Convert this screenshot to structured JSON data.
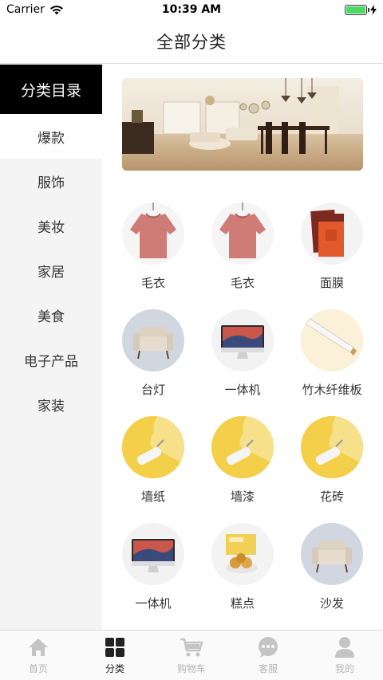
{
  "status": {
    "carrier": "Carrier",
    "time": "10:39 AM"
  },
  "nav": {
    "title": "全部分类"
  },
  "sidebar": {
    "header": "分类目录",
    "items": [
      {
        "label": "爆款",
        "active": true
      },
      {
        "label": "服饰"
      },
      {
        "label": "美妆"
      },
      {
        "label": "家居"
      },
      {
        "label": "美食"
      },
      {
        "label": "电子产品"
      },
      {
        "label": "家装"
      }
    ]
  },
  "banner": {
    "image": "living-room-photo"
  },
  "products": [
    {
      "label": "毛衣",
      "icon": "sweater"
    },
    {
      "label": "毛衣",
      "icon": "sweater"
    },
    {
      "label": "面膜",
      "icon": "face-mask"
    },
    {
      "label": "台灯",
      "icon": "armchair"
    },
    {
      "label": "一体机",
      "icon": "imac"
    },
    {
      "label": "竹木纤维板",
      "icon": "molding"
    },
    {
      "label": "墙纸",
      "icon": "paint-roller"
    },
    {
      "label": "墙漆",
      "icon": "paint-roller"
    },
    {
      "label": "花砖",
      "icon": "paint-roller"
    },
    {
      "label": "一体机",
      "icon": "imac"
    },
    {
      "label": "糕点",
      "icon": "pastry"
    },
    {
      "label": "沙发",
      "icon": "armchair"
    }
  ],
  "tabs": [
    {
      "label": "首页",
      "icon": "home-icon"
    },
    {
      "label": "分类",
      "icon": "category-icon",
      "active": true
    },
    {
      "label": "购物车",
      "icon": "cart-icon"
    },
    {
      "label": "客服",
      "icon": "chat-icon"
    },
    {
      "label": "我的",
      "icon": "profile-icon"
    }
  ],
  "colors": {
    "active_text": "#222222",
    "inactive_tab": "#b5b5b5",
    "sidebar_bg": "#f4f4f4",
    "sidebar_header_bg": "#000000"
  }
}
